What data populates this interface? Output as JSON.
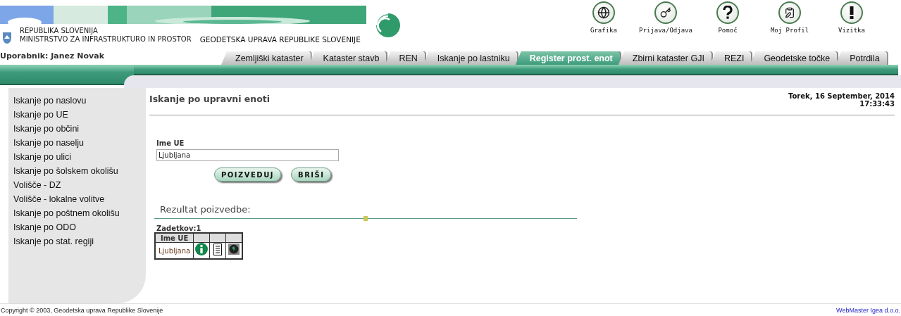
{
  "header": {
    "org_lines": [
      "REPUBLIKA SLOVENIJA",
      "MINISTRSTVO ZA INFRASTRUKTURO IN PROSTOR"
    ],
    "agency": "GEODETSKA UPRAVA REPUBLIKE SLOVENIJE",
    "user": "Uporabnik: Janez Novak"
  },
  "toolbar": [
    {
      "kind": "globe",
      "label": "Grafika"
    },
    {
      "kind": "key",
      "label": "Prijava/Odjava"
    },
    {
      "kind": "help",
      "label": "Pomoč"
    },
    {
      "kind": "clipboard",
      "label": "Moj Profil"
    },
    {
      "kind": "alert",
      "label": "Vizitka"
    }
  ],
  "tabs": [
    {
      "label": "Zemljiški kataster",
      "selected": false
    },
    {
      "label": "Kataster stavb",
      "selected": false
    },
    {
      "label": "REN",
      "selected": false
    },
    {
      "label": "Iskanje po lastniku",
      "selected": false
    },
    {
      "label": "Register prost. enot",
      "selected": true
    },
    {
      "label": "Zbirni kataster GJI",
      "selected": false
    },
    {
      "label": "REZI",
      "selected": false
    },
    {
      "label": "Geodetske točke",
      "selected": false
    },
    {
      "label": "Potrdila",
      "selected": false
    }
  ],
  "sidebar": {
    "items": [
      "Iskanje po naslovu",
      "Iskanje po UE",
      "Iskanje po občini",
      "Iskanje po naselju",
      "Iskanje po ulici",
      "Iskanje po šolskem okolišu",
      "Volišče - DZ",
      "Volišče - lokalne volitve",
      "Iskanje po poštnem okolišu",
      "Iskanje po ODO",
      "Iskanje po stat. regiji"
    ]
  },
  "page": {
    "title": "Iskanje po upravni enoti",
    "date": "Torek, 16 September, 2014",
    "time": "17:33:43"
  },
  "form": {
    "label": "Ime UE",
    "value": "Ljubljana",
    "buttons": [
      "POIZVEDUJ",
      "BRIŠI"
    ]
  },
  "results": {
    "heading": "Rezultat poizvedbe:",
    "count": "Zadetkov:1",
    "column": "Ime UE",
    "actions": [
      {
        "kind": "info"
      },
      {
        "kind": "document"
      },
      {
        "kind": "globe"
      }
    ],
    "rows": [
      {
        "name": "Ljubljana"
      }
    ]
  },
  "footer": {
    "copyright": "Copyright © 2003, Geodetska uprava Republike Slovenije",
    "webmaster": "WebMaster Igea d.o.o."
  }
}
